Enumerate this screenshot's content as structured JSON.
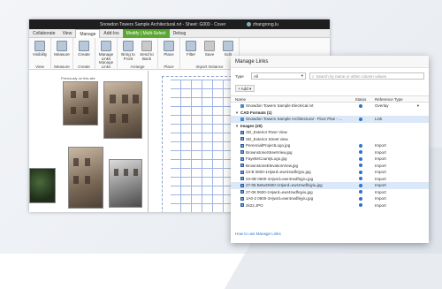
{
  "window": {
    "title": "Snowdon Towers Sample Architectural.rvt - Sheet: G000 - Cover",
    "user": "zhangrong.lu"
  },
  "ribbon_tabs": [
    {
      "label": "Collaborate"
    },
    {
      "label": "View"
    },
    {
      "label": "Manage",
      "active": true
    },
    {
      "label": "Add-Ins"
    },
    {
      "label": "Modify | Multi-Select",
      "highlight": true
    },
    {
      "label": "Debug"
    }
  ],
  "ribbon_groups": [
    {
      "label": "View",
      "buttons": [
        "Visibility"
      ]
    },
    {
      "label": "Measure",
      "buttons": [
        "Measure"
      ]
    },
    {
      "label": "Create",
      "buttons": [
        "Create"
      ]
    },
    {
      "label": "Manage Links",
      "buttons": [
        "Manage Links"
      ]
    },
    {
      "label": "Arrange",
      "buttons": [
        "Bring to Front",
        "Send to Back"
      ]
    },
    {
      "label": "Place",
      "buttons": [
        "Place"
      ]
    },
    {
      "label": "Import Instance",
      "buttons": [
        "Filter",
        "Save",
        "Edit"
      ]
    }
  ],
  "sheet": {
    "caption": "Previously on this site"
  },
  "dialog": {
    "title": "Manage Links",
    "type_label": "Type",
    "type_value": "All",
    "search_placeholder": "Search by name or other column values",
    "add_label": "Add",
    "columns": {
      "name": "Name",
      "status": "Status",
      "reference": "Reference Type"
    },
    "rows": [
      {
        "kind": "file",
        "name": "Snowdon Towers Sample Electrical.rvt",
        "status": true,
        "ref": "Overlay",
        "dropdown": true
      },
      {
        "kind": "group",
        "name": "CAD Formats (1)"
      },
      {
        "kind": "file",
        "name": "Snowdon Towers Sample Architectural - Floor Plan - ...",
        "status": true,
        "ref": "Link",
        "selected": true
      },
      {
        "kind": "group",
        "name": "Images (20)"
      },
      {
        "kind": "img",
        "name": "SD_Exterior River View",
        "status": false,
        "ref": ""
      },
      {
        "kind": "img",
        "name": "SD_Exterior Street view",
        "status": false,
        "ref": ""
      },
      {
        "kind": "img",
        "name": "PerennialProjectLogo.jpg",
        "status": true,
        "ref": "Import"
      },
      {
        "kind": "img",
        "name": "BrownstoneStreetView.jpg",
        "status": true,
        "ref": "Import"
      },
      {
        "kind": "img",
        "name": "FayetteCountyLogo.jpg",
        "status": true,
        "ref": "Import"
      },
      {
        "kind": "img",
        "name": "BrownstoneElevationView.jpg",
        "status": true,
        "ref": "Import"
      },
      {
        "kind": "img",
        "name": "23-B 0600-1Hjwrd=ewr4rwdfejyiu.jpg",
        "status": true,
        "ref": "Import"
      },
      {
        "kind": "img",
        "name": "23-0B 0600-1Hjwrd=ewr4rwdfejyiu.jpg",
        "status": true,
        "ref": "Import"
      },
      {
        "kind": "img",
        "name": "27-06 BetwO600-1Hjwrd=ewr4rwdfejyiu.jpg",
        "status": true,
        "ref": "Import",
        "selected": true
      },
      {
        "kind": "img",
        "name": "27-08 0600-1Hjwrd=ewr4rwdfejyiu.jpg",
        "status": true,
        "ref": "Import"
      },
      {
        "kind": "img",
        "name": "1A0-2 0600-1Hjwrd=ewr4rwdfejyiu.jpg",
        "status": true,
        "ref": "Import"
      },
      {
        "kind": "img",
        "name": "2k22.JPG",
        "status": true,
        "ref": "Import"
      }
    ],
    "help_link": "How to use Manage Links"
  },
  "colors": {
    "accent": "#2d73c6",
    "modify_tab": "#5aa832",
    "selected_row": "#dbe8f7"
  }
}
